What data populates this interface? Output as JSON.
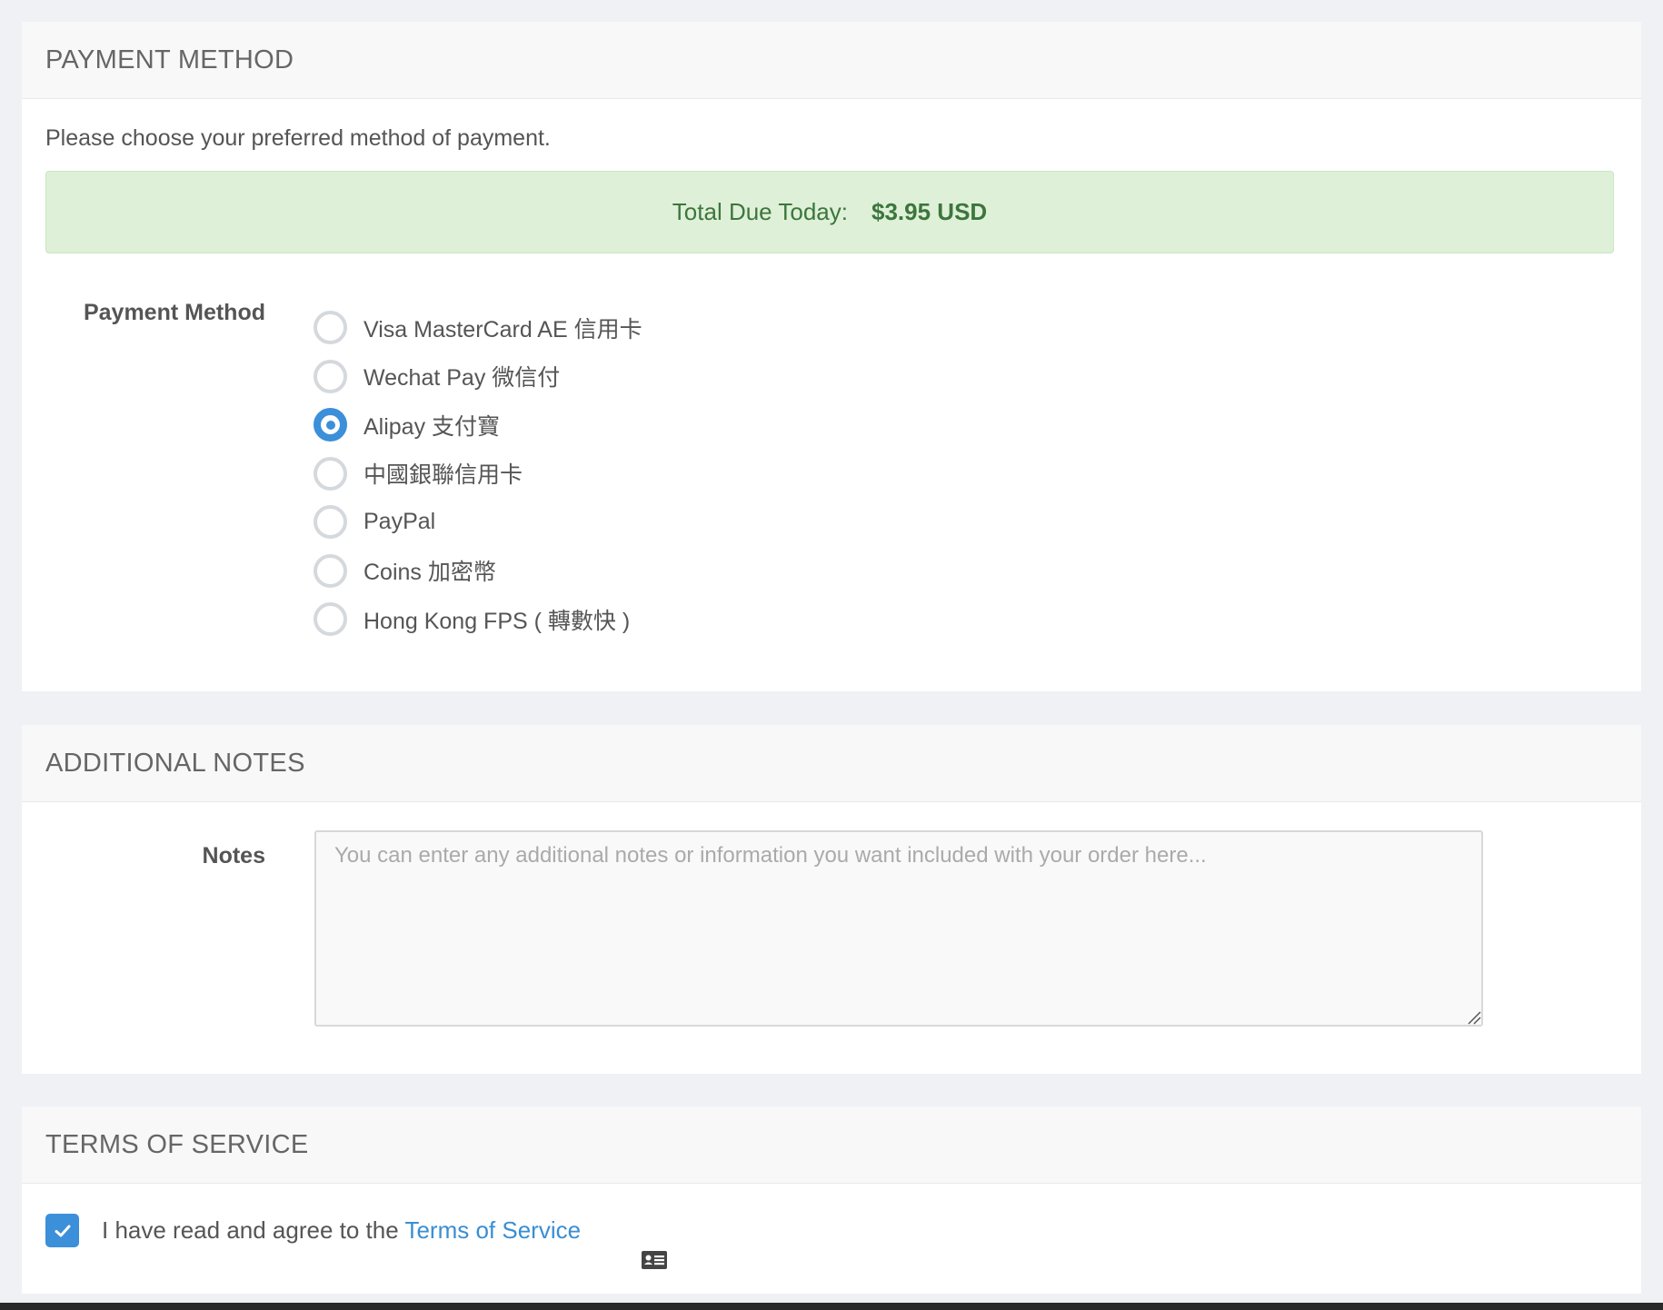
{
  "payment_panel": {
    "title": "PAYMENT METHOD",
    "intro": "Please choose your preferred method of payment.",
    "total_label": "Total Due Today:",
    "total_amount": "$3.95 USD",
    "field_label": "Payment Method",
    "options": [
      {
        "label": "Visa MasterCard AE 信用卡",
        "selected": false
      },
      {
        "label": "Wechat Pay 微信付",
        "selected": false
      },
      {
        "label": "Alipay 支付寶",
        "selected": true
      },
      {
        "label": "中國銀聯信用卡",
        "selected": false
      },
      {
        "label": "PayPal",
        "selected": false
      },
      {
        "label": "Coins 加密幣",
        "selected": false
      },
      {
        "label": "Hong Kong FPS ( 轉數快 )",
        "selected": false
      }
    ]
  },
  "notes_panel": {
    "title": "ADDITIONAL NOTES",
    "field_label": "Notes",
    "value": "",
    "placeholder": "You can enter any additional notes or information you want included with your order here..."
  },
  "tos_panel": {
    "title": "TERMS OF SERVICE",
    "agree_text": "I have read and agree to the ",
    "link_text": "Terms of Service",
    "checked": true
  },
  "colors": {
    "accent": "#3c8fd9",
    "success_bg": "#dff0d8",
    "success_text": "#3c763d",
    "page_bg": "#eff1f5"
  },
  "icons": {
    "checkbox": "check-icon",
    "card": "id-card-icon"
  }
}
